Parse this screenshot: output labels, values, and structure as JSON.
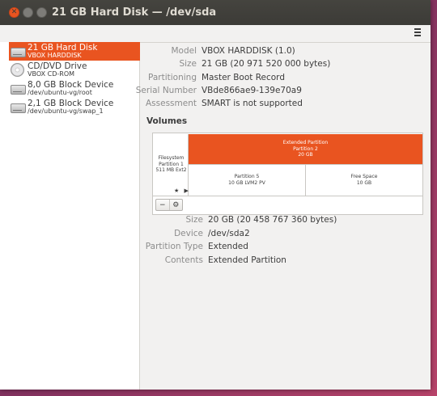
{
  "window": {
    "title": "21 GB Hard Disk — /dev/sda",
    "controls": {
      "close": "✕",
      "minimize": "–",
      "maximize": "□"
    },
    "menu_icon": "hamburger-menu-icon"
  },
  "sidebar": {
    "items": [
      {
        "title": "21 GB Hard Disk",
        "subtitle": "VBOX HARDDISK",
        "icon": "hard-disk-icon",
        "selected": true
      },
      {
        "title": "CD/DVD Drive",
        "subtitle": "VBOX CD-ROM",
        "icon": "optical-disc-icon",
        "selected": false
      },
      {
        "title": "8,0 GB Block Device",
        "subtitle": "/dev/ubuntu-vg/root",
        "icon": "hard-disk-icon",
        "selected": false
      },
      {
        "title": "2,1 GB Block Device",
        "subtitle": "/dev/ubuntu-vg/swap_1",
        "icon": "hard-disk-icon",
        "selected": false
      }
    ]
  },
  "disk_info": {
    "model_label": "Model",
    "model": "VBOX HARDDISK (1.0)",
    "size_label": "Size",
    "size": "21 GB (20 971 520 000 bytes)",
    "partitioning_label": "Partitioning",
    "partitioning": "Master Boot Record",
    "serial_label": "Serial Number",
    "serial": "VBde866ae9-139e70a9",
    "assessment_label": "Assessment",
    "assessment": "SMART is not supported"
  },
  "volumes": {
    "title": "Volumes",
    "filesystem": {
      "line1": "Filesystem",
      "line2": "Partition 1",
      "line3": "511 MB Ext2",
      "controls": "★ ▶"
    },
    "extended": {
      "line1": "Extended Partition",
      "line2": "Partition 2",
      "line3": "20 GB"
    },
    "partition5": {
      "line1": "Partition 5",
      "line2": "10 GB LVM2 PV"
    },
    "free": {
      "line1": "Free Space",
      "line2": "10 GB"
    },
    "buttons": {
      "minus": "−",
      "gear": "⚙"
    }
  },
  "partition_info": {
    "size_label": "Size",
    "size": "20 GB (20 458 767 360 bytes)",
    "device_label": "Device",
    "device": "/dev/sda2",
    "type_label": "Partition Type",
    "type": "Extended",
    "contents_label": "Contents",
    "contents": "Extended Partition"
  },
  "colors": {
    "accent": "#e95420",
    "titlebar": "#3c3b37",
    "background": "#f2f1f0"
  }
}
